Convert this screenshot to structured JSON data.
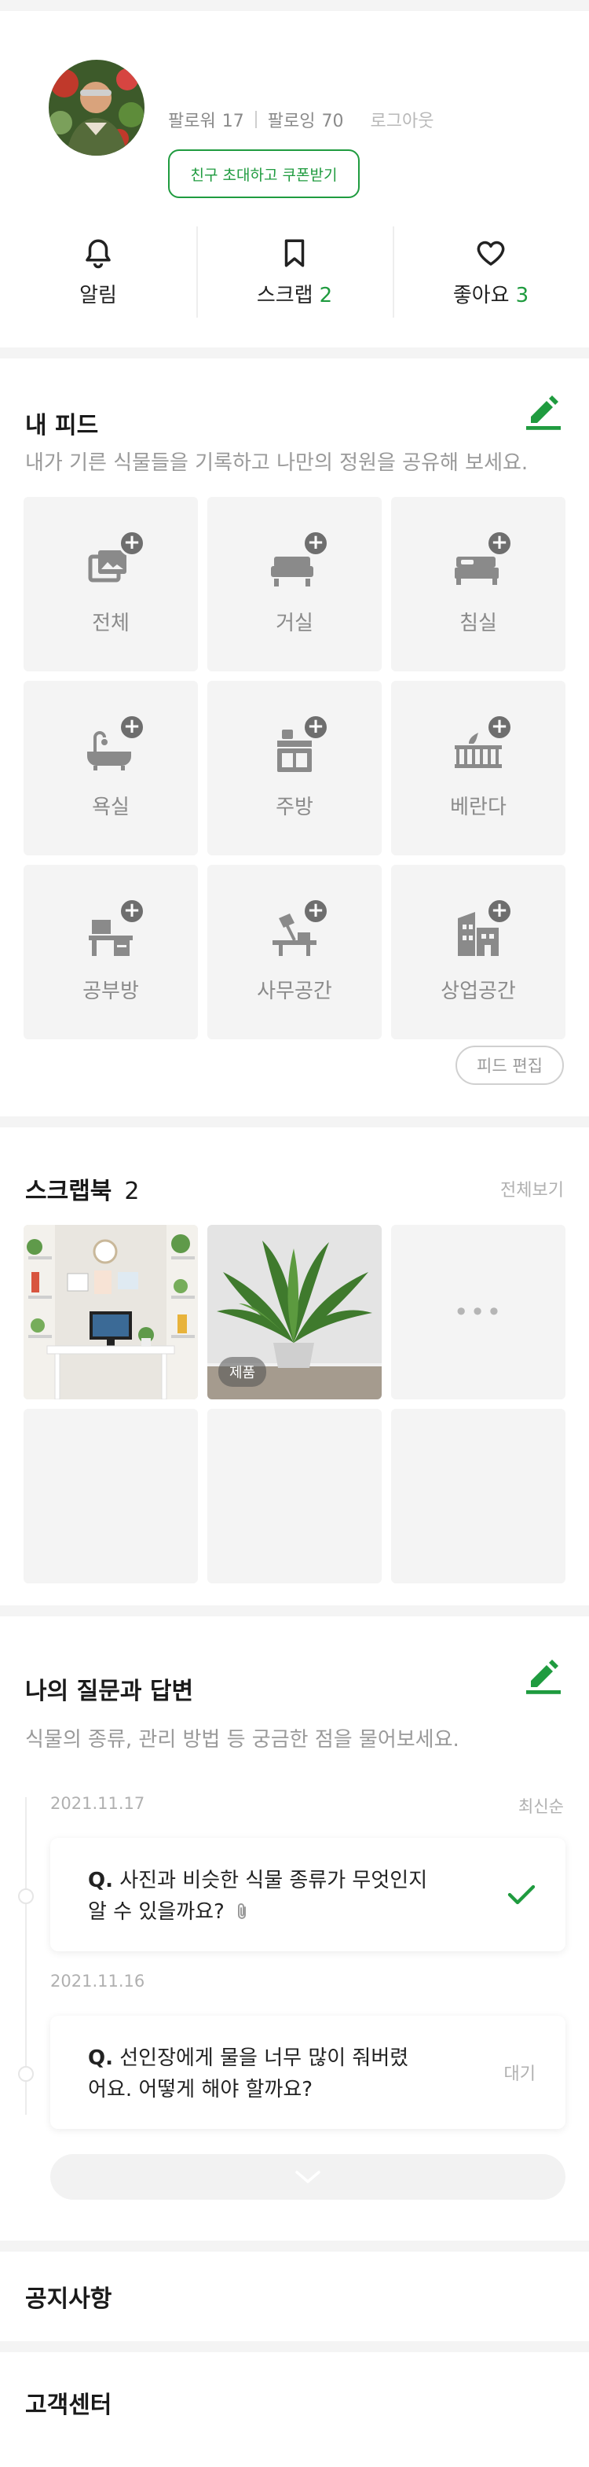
{
  "profile": {
    "followers_label": "팔로워",
    "followers_count": "17",
    "following_label": "팔로잉",
    "following_count": "70",
    "logout_label": "로그아웃",
    "invite_label": "친구 초대하고 쿠폰받기"
  },
  "quick_menu": {
    "alarm_label": "알림",
    "scrap_label": "스크랩",
    "scrap_count": "2",
    "like_label": "좋아요",
    "like_count": "3"
  },
  "feed": {
    "title": "내 피드",
    "description": "내가 기른 식물들을 기록하고 나만의 정원을 공유해 보세요.",
    "rooms": [
      {
        "label": "전체",
        "icon": "gallery-icon"
      },
      {
        "label": "거실",
        "icon": "sofa-icon"
      },
      {
        "label": "침실",
        "icon": "bed-icon"
      },
      {
        "label": "욕실",
        "icon": "bathtub-icon"
      },
      {
        "label": "주방",
        "icon": "kitchen-icon"
      },
      {
        "label": "베란다",
        "icon": "balcony-icon"
      },
      {
        "label": "공부방",
        "icon": "desk-icon"
      },
      {
        "label": "사무공간",
        "icon": "office-lamp-icon"
      },
      {
        "label": "상업공간",
        "icon": "building-icon"
      }
    ],
    "edit_label": "피드 편집"
  },
  "scrapbook": {
    "title": "스크랩북",
    "count": "2",
    "see_all_label": "전체보기",
    "product_badge": "제품"
  },
  "qa": {
    "title": "나의 질문과 답변",
    "description": "식물의 종류, 관리 방법 등 궁금한 점을 물어보세요.",
    "sort_label": "최신순",
    "items": [
      {
        "date": "2021.11.17",
        "prefix": "Q.",
        "line1": "사진과 비슷한 식물 종류가 무엇인지",
        "line2": "알 수 있을까요?",
        "status": "answered"
      },
      {
        "date": "2021.11.16",
        "prefix": "Q.",
        "line1": "선인장에게 물을 너무 많이 줘버렸",
        "line2": "어요. 어떻게 해야 할까요?",
        "status": "대기"
      }
    ]
  },
  "menu": {
    "notice_label": "공지사항",
    "support_label": "고객센터"
  },
  "colors": {
    "accent": "#1f9b3f",
    "icon_gray": "#6e6e6e",
    "tile_bg": "#f4f4f4"
  }
}
